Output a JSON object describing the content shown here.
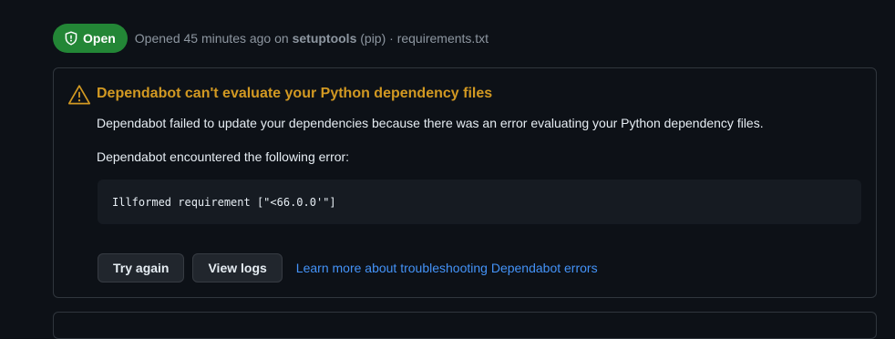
{
  "header": {
    "status": "Open",
    "opened_prefix": "Opened 45 minutes ago on ",
    "package": "setuptools",
    "ecosystem_suffix": " (pip) · requirements.txt"
  },
  "alert": {
    "title": "Dependabot can't evaluate your Python dependency files",
    "description": "Dependabot failed to update your dependencies because there was an error evaluating your Python dependency files.",
    "error_intro": "Dependabot encountered the following error:",
    "error_code": "Illformed requirement [\"<66.0.0'\"]"
  },
  "actions": {
    "try_again": "Try again",
    "view_logs": "View logs",
    "learn_more": "Learn more about troubleshooting Dependabot errors"
  },
  "icons": {
    "status": "shield-icon",
    "alert": "alert-triangle-icon"
  },
  "colors": {
    "open_badge": "#238636",
    "warning": "#d29922",
    "link": "#4493f8",
    "background": "#0d1117"
  }
}
